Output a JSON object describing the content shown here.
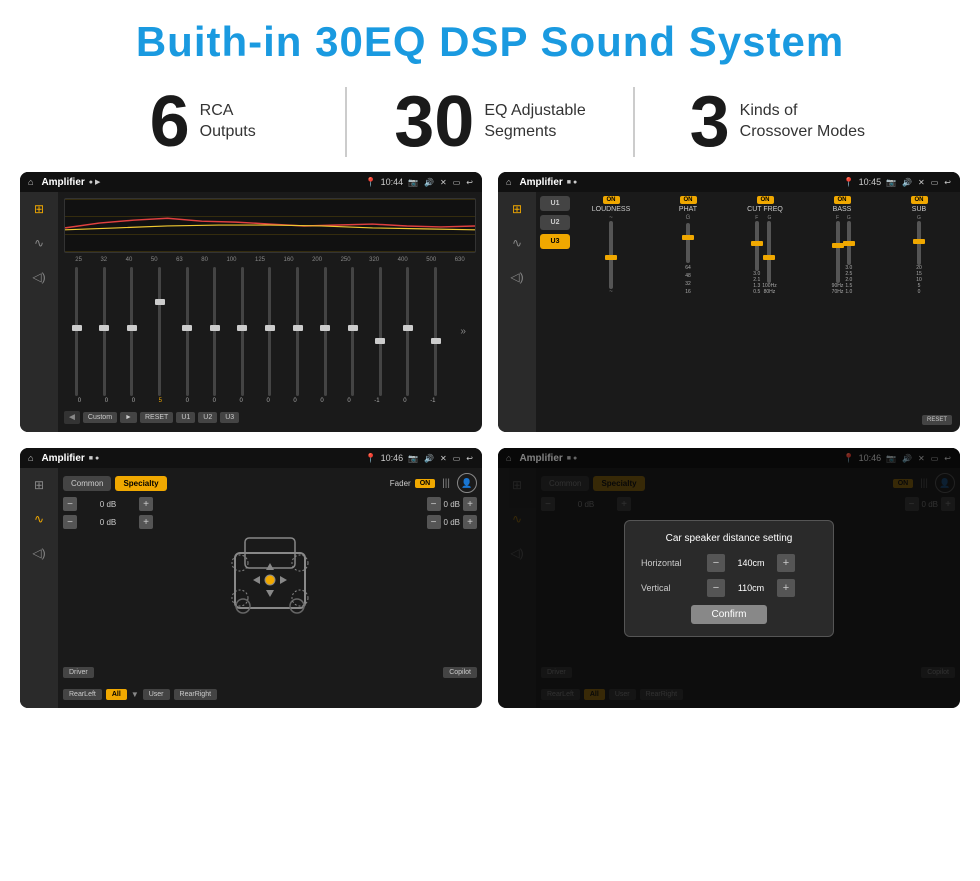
{
  "header": {
    "title": "Buith-in 30EQ DSP Sound System"
  },
  "stats": [
    {
      "number": "6",
      "text_line1": "RCA",
      "text_line2": "Outputs"
    },
    {
      "number": "30",
      "text_line1": "EQ Adjustable",
      "text_line2": "Segments"
    },
    {
      "number": "3",
      "text_line1": "Kinds of",
      "text_line2": "Crossover Modes"
    }
  ],
  "screens": {
    "eq": {
      "title": "Amplifier",
      "time": "10:44",
      "freq_labels": [
        "25",
        "32",
        "40",
        "50",
        "63",
        "80",
        "100",
        "125",
        "160",
        "200",
        "250",
        "320",
        "400",
        "500",
        "630"
      ],
      "slider_values": [
        "0",
        "0",
        "0",
        "5",
        "0",
        "0",
        "0",
        "0",
        "0",
        "0",
        "0",
        "-1",
        "0",
        "-1"
      ],
      "buttons": [
        "Custom",
        "RESET",
        "U1",
        "U2",
        "U3"
      ]
    },
    "crossover": {
      "title": "Amplifier",
      "time": "10:45",
      "presets": [
        "U1",
        "U2",
        "U3"
      ],
      "controls": [
        "LOUDNESS",
        "PHAT",
        "CUT FREQ",
        "BASS",
        "SUB"
      ],
      "on_states": [
        true,
        true,
        true,
        true,
        true
      ]
    },
    "fader": {
      "title": "Amplifier",
      "time": "10:46",
      "tabs": [
        "Common",
        "Specialty"
      ],
      "fader_label": "Fader",
      "on_text": "ON",
      "db_values": [
        "0 dB",
        "0 dB",
        "0 dB",
        "0 dB"
      ],
      "bottom_buttons": [
        "Driver",
        "Copilot",
        "RearLeft",
        "All",
        "User",
        "RearRight"
      ]
    },
    "distance": {
      "title": "Amplifier",
      "time": "10:46",
      "tabs": [
        "Common",
        "Specialty"
      ],
      "on_text": "ON",
      "dialog_title": "Car speaker distance setting",
      "horizontal_label": "Horizontal",
      "horizontal_value": "140cm",
      "vertical_label": "Vertical",
      "vertical_value": "110cm",
      "confirm_label": "Confirm",
      "db_values": [
        "0 dB",
        "0 dB"
      ],
      "bottom_buttons": [
        "Driver",
        "Copilot",
        "RearLeft",
        "All",
        "User",
        "RearRight"
      ]
    }
  }
}
